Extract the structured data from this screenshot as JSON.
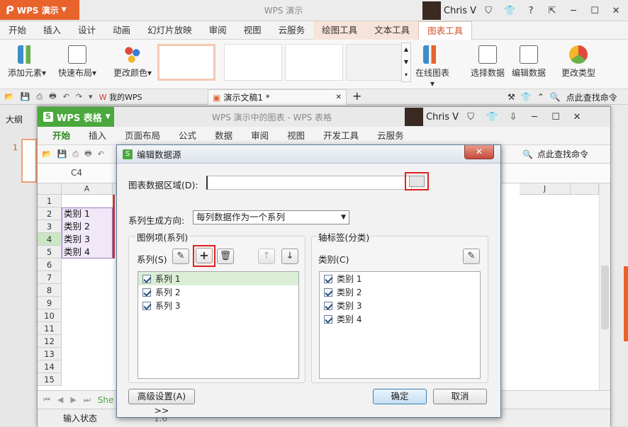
{
  "ppt": {
    "app_button": "WPS 演示",
    "title": "WPS 演示",
    "user": "Chris V",
    "help": "?",
    "tabs": [
      "开始",
      "插入",
      "设计",
      "动画",
      "幻灯片放映",
      "审阅",
      "视图",
      "云服务",
      "绘图工具",
      "文本工具",
      "图表工具"
    ],
    "active_tab": "图表工具",
    "ribbon": {
      "add_element": "添加元素",
      "quick_layout": "快速布局",
      "change_color": "更改颜色",
      "online_chart": "在线图表",
      "select_data": "选择数据",
      "edit_data": "编辑数据",
      "change_type": "更改类型"
    },
    "doc_tabs": [
      "我的WPS",
      "演示文稿1 *"
    ],
    "search": "点此查找命令",
    "outline_tab": "大纲",
    "slide_number": "1"
  },
  "et": {
    "app_button": "WPS 表格",
    "title": "WPS 演示中的图表 - WPS 表格",
    "user": "Chris V",
    "tabs": [
      "开始",
      "插入",
      "页面布局",
      "公式",
      "数据",
      "审阅",
      "视图",
      "开发工具",
      "云服务"
    ],
    "search": "点此查找命令",
    "name_box": "C4",
    "col_a": "A",
    "col_j": "J",
    "rows": [
      "1",
      "2",
      "3",
      "4",
      "5",
      "6",
      "7",
      "8",
      "9",
      "10",
      "11",
      "12",
      "13",
      "14",
      "15"
    ],
    "cells": {
      "a2": "类别 1",
      "a3": "类别 2",
      "a4": "类别 3",
      "a5": "类别 4"
    },
    "sheet_tab": "She",
    "status": "输入状态",
    "status_value": "1.6"
  },
  "dialog": {
    "title": "编辑数据源",
    "range_label": "图表数据区域(D):",
    "range_value": "",
    "direction_label": "系列生成方向:",
    "direction_value": "每列数据作为一个系列",
    "legend_group": "图例项(系列)",
    "series_label": "系列(S)",
    "series": [
      "系列 1",
      "系列 2",
      "系列 3"
    ],
    "axis_group": "轴标签(分类)",
    "category_label": "类别(C)",
    "categories": [
      "类别 1",
      "类别 2",
      "类别 3",
      "类别 4"
    ],
    "advanced": "高级设置(A) >>",
    "ok": "确定",
    "cancel": "取消"
  },
  "colors": {
    "wps_ppt": "#e8622c",
    "wps_et": "#4aa83d",
    "highlight": "#e02020"
  }
}
